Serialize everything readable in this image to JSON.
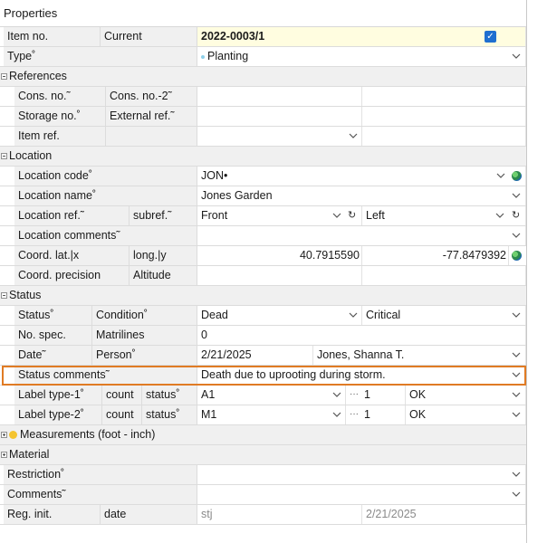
{
  "title": "Properties",
  "item_no": {
    "label": "Item no.",
    "sub": "Current",
    "value": "2022-0003/1"
  },
  "type": {
    "label": "Type˚",
    "value": "Planting"
  },
  "references": {
    "label": "References",
    "cons_no": "Cons. no.˜",
    "cons_no2": "Cons. no.-2˜",
    "storage_no": "Storage no.˚",
    "external_ref": "External ref.˜",
    "item_ref": "Item ref."
  },
  "location": {
    "label": "Location",
    "code_label": "Location code˚",
    "code_value": "JON•",
    "name_label": "Location name˚",
    "name_value": "Jones Garden",
    "ref_label": "Location ref.˜",
    "subref_label": "subref.˜",
    "ref_value": "Front",
    "subref_value": "Left",
    "comments_label": "Location comments˜",
    "coord_label": "Coord. lat.|x",
    "long_label": "long.|y",
    "lat_value": "40.7915590",
    "long_value": "-77.8479392",
    "precision_label": "Coord. precision",
    "altitude_label": "Altitude"
  },
  "status": {
    "label": "Status",
    "status_label": "Status˚",
    "condition_label": "Condition˚",
    "status_value": "Dead",
    "condition_value": "Critical",
    "nospec_label": "No. spec.",
    "matrilines_label": "Matrilines",
    "nospec_value": "0",
    "date_label": "Date˜",
    "person_label": "Person˚",
    "date_value": "2/21/2025",
    "person_value": "Jones, Shanna T.",
    "comments_label": "Status comments˜",
    "comments_value": "Death due to uprooting during storm.",
    "label1": {
      "label": "Label type-1˚",
      "count": "count",
      "status": "status˚",
      "type_value": "A1",
      "count_value": "1",
      "status_value": "OK"
    },
    "label2": {
      "label": "Label type-2˚",
      "count": "count",
      "status": "status˚",
      "type_value": "M1",
      "count_value": "1",
      "status_value": "OK"
    }
  },
  "measurements": {
    "label": "Measurements (foot - inch)"
  },
  "material": {
    "label": "Material"
  },
  "restriction": {
    "label": "Restriction˚"
  },
  "comments": {
    "label": "Comments˜"
  },
  "reg": {
    "label": "Reg. init.",
    "date_label": "date",
    "init_value": "stj",
    "date_value": "2/21/2025"
  },
  "colors": {
    "accent": "#e07b24",
    "checkbox": "#1f6fd0",
    "highlight": "#fffde0"
  },
  "icons": [
    "chevron-down-icon",
    "globe-icon",
    "refresh-icon",
    "ellipsis-icon",
    "checkbox-icon",
    "expand-icon",
    "collapse-icon"
  ]
}
